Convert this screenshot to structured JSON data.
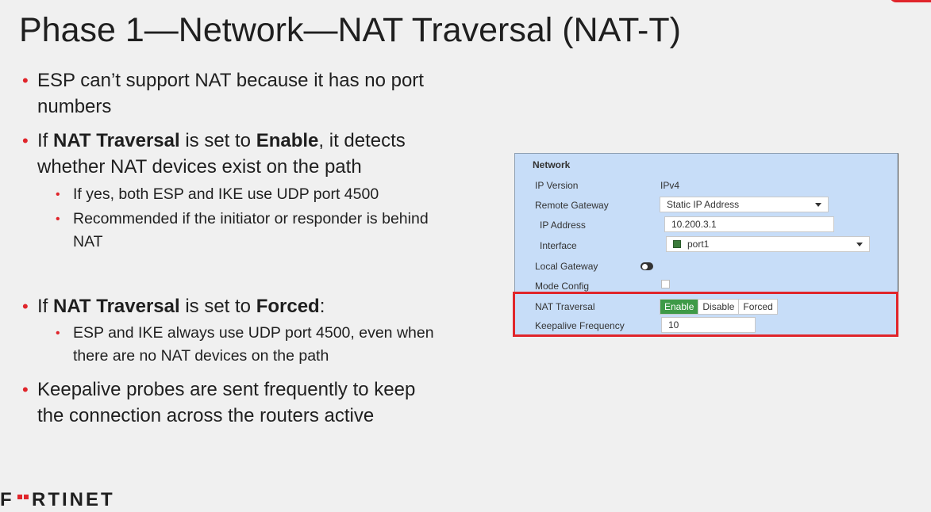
{
  "title": "Phase 1—Network—NAT Traversal (NAT-T)",
  "bullets": {
    "b1_line1": "ESP can’t support NAT because it has no port",
    "b1_line2": "numbers",
    "b2_pre": "If ",
    "b2_bold1": "NAT Traversal",
    "b2_mid": " is set to ",
    "b2_bold2": "Enable",
    "b2_post": ", it detects",
    "b2_line2": "whether NAT devices exist on the path",
    "b2_sub1": "If yes, both ESP and IKE use UDP port 4500",
    "b2_sub2_line1": "Recommended if the initiator or responder is behind",
    "b2_sub2_line2": "NAT",
    "b3_pre": "If ",
    "b3_bold1": "NAT Traversal",
    "b3_mid": " is set to ",
    "b3_bold2": "Forced",
    "b3_post": ":",
    "b3_sub1_line1": "ESP and IKE always use UDP port 4500, even when",
    "b3_sub1_line2": "there are no NAT devices on the path",
    "b4_line1": "Keepalive probes are sent frequently to keep",
    "b4_line2": "the connection across the routers active"
  },
  "panel": {
    "heading": "Network",
    "ip_version_label": "IP Version",
    "ip_version_value": "IPv4",
    "remote_gateway_label": "Remote Gateway",
    "remote_gateway_value": "Static IP Address",
    "ip_address_label": "IP Address",
    "ip_address_value": "10.200.3.1",
    "interface_label": "Interface",
    "interface_value": "port1",
    "local_gateway_label": "Local Gateway",
    "mode_config_label": "Mode Config",
    "nat_traversal_label": "NAT Traversal",
    "nat_options": [
      "Enable",
      "Disable",
      "Forced"
    ],
    "nat_selected": "Enable",
    "keepalive_label": "Keepalive Frequency",
    "keepalive_value": "10"
  },
  "colors": {
    "accent": "#e0252b",
    "panel_bg": "#c7ddf8",
    "active_green": "#3e9a47"
  },
  "logo": "F::RTINET"
}
